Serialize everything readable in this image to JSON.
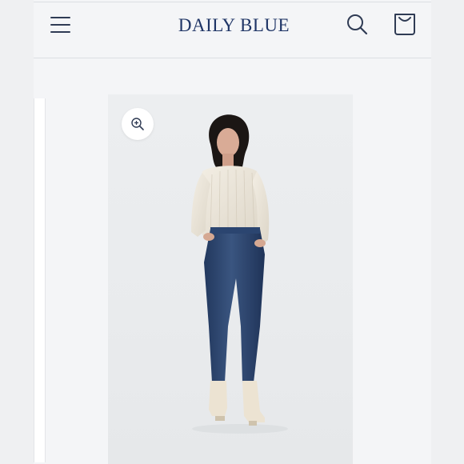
{
  "header": {
    "brand": "DAILY BLUE",
    "icons": {
      "menu": "hamburger-menu-icon",
      "search": "search-icon",
      "cart": "shopping-bag-icon"
    },
    "brand_color": "#1f3566"
  },
  "product": {
    "image": "model-wearing-cream-knit-sweater-and-straight-leg-jeans",
    "zoom_icon": "zoom-in-icon"
  }
}
